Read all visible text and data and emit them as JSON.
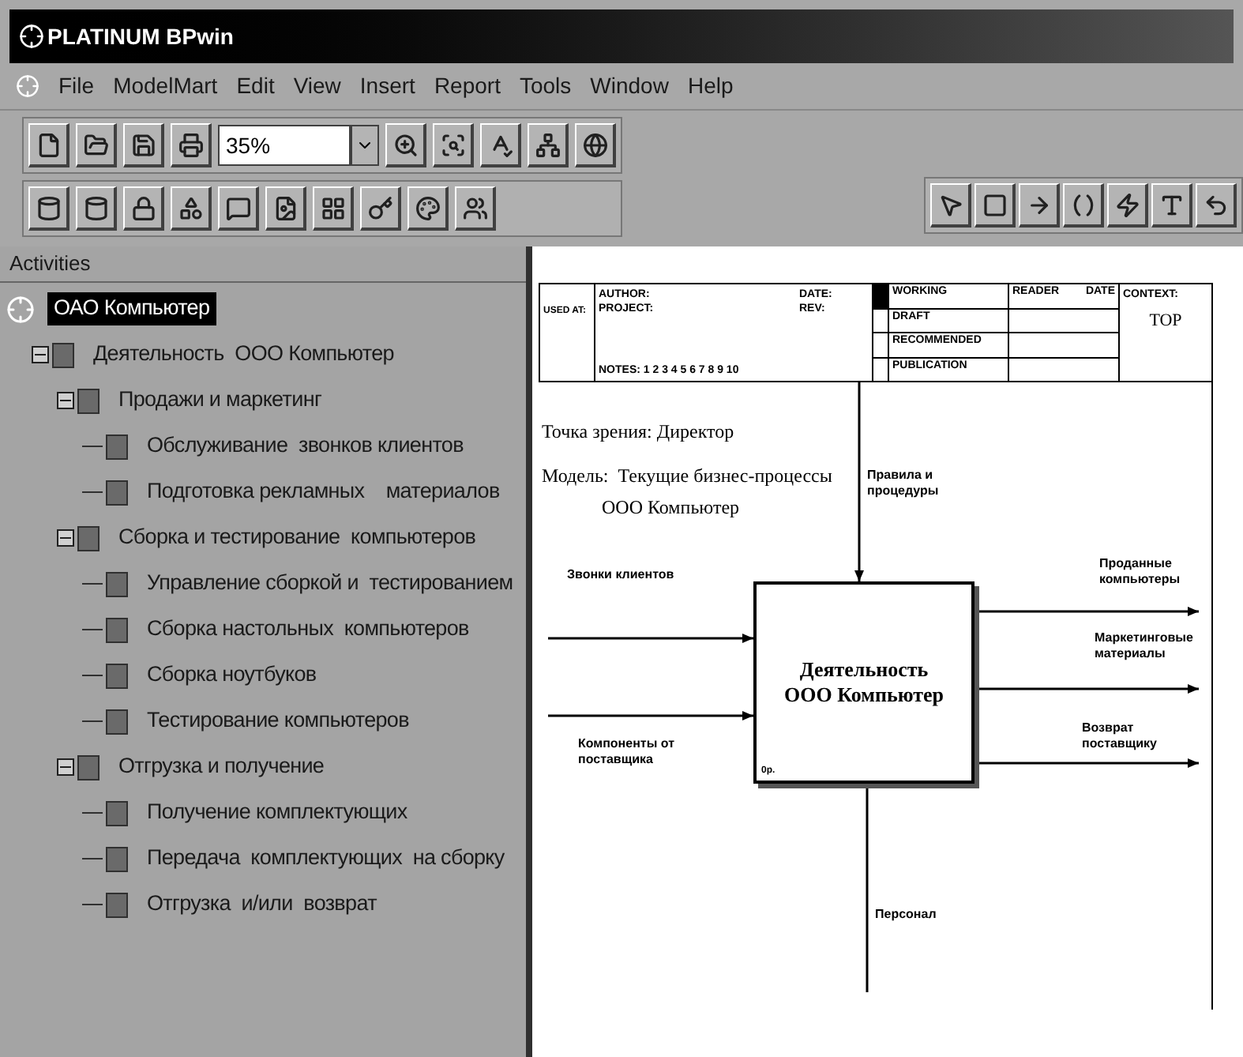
{
  "window": {
    "title": "PLATINUM BPwin"
  },
  "menu": [
    "File",
    "ModelMart",
    "Edit",
    "View",
    "Insert",
    "Report",
    "Tools",
    "Window",
    "Help"
  ],
  "toolbar": {
    "zoom": "35%"
  },
  "activities_panel": {
    "title": "Activities",
    "tree": [
      {
        "label": "ОАО Компьютер",
        "kind": "model",
        "selected": true,
        "children": [
          {
            "label": "Деятельность  ООО Компьютер",
            "kind": "activity",
            "selected": false,
            "expanded": true,
            "children": [
              {
                "label": "Продажи и маркетинг",
                "kind": "activity",
                "selected": false,
                "expanded": true,
                "children": [
                  {
                    "label": "Обслуживание  звонков клиентов",
                    "kind": "activity",
                    "selected": false
                  },
                  {
                    "label": "Подготовка рекламных    материалов",
                    "kind": "activity",
                    "selected": false
                  }
                ]
              },
              {
                "label": "Сборка и тестирование  компьютеров",
                "kind": "activity",
                "selected": false,
                "expanded": true,
                "children": [
                  {
                    "label": "Управление сборкой и  тестированием",
                    "kind": "activity",
                    "selected": false
                  },
                  {
                    "label": "Сборка настольных  компьютеров",
                    "kind": "activity",
                    "selected": false
                  },
                  {
                    "label": "Сборка ноутбуков",
                    "kind": "activity",
                    "selected": false
                  },
                  {
                    "label": "Тестирование компьютеров",
                    "kind": "activity",
                    "selected": false
                  }
                ]
              },
              {
                "label": "Отгрузка и получение",
                "kind": "activity",
                "selected": false,
                "expanded": true,
                "children": [
                  {
                    "label": "Получение комплектующих",
                    "kind": "activity",
                    "selected": false
                  },
                  {
                    "label": "Передача  комплектующих  на сборку",
                    "kind": "activity",
                    "selected": false
                  },
                  {
                    "label": "Отгрузка  и/или  возврат",
                    "kind": "activity",
                    "selected": false
                  }
                ]
              }
            ]
          }
        ]
      }
    ]
  },
  "diagram": {
    "header": {
      "used_at": "USED AT:",
      "author": "AUTHOR:",
      "project": "PROJECT:",
      "notes": "NOTES: 1 2 3 4 5 6 7 8 9 10",
      "date": "DATE:",
      "rev": "REV:",
      "status": [
        {
          "label": "WORKING",
          "selected": true
        },
        {
          "label": "DRAFT",
          "selected": false
        },
        {
          "label": "RECOMMENDED",
          "selected": false
        },
        {
          "label": "PUBLICATION",
          "selected": false
        }
      ],
      "reader": "READER",
      "reader_date": "DATE",
      "context": "CONTEXT:",
      "node": "TOP"
    },
    "viewpoint": "Точка зрения: Директор",
    "model_lines": [
      "Модель:  Текущие бизнес-процессы",
      "ООО Компьютер"
    ],
    "activity": {
      "title": "Деятельность ООО Компьютер",
      "cost": "0р."
    },
    "arrows": [
      {
        "kind": "control",
        "label": "Правила и процедуры"
      },
      {
        "kind": "input",
        "label": "Звонки клиентов"
      },
      {
        "kind": "input",
        "label": "Компоненты от поставщика"
      },
      {
        "kind": "output",
        "label": "Проданные компьютеры"
      },
      {
        "kind": "output",
        "label": "Маркетинговые материалы"
      },
      {
        "kind": "output",
        "label": "Возврат поставщику"
      },
      {
        "kind": "mechanism",
        "label": "Персонал"
      }
    ]
  }
}
